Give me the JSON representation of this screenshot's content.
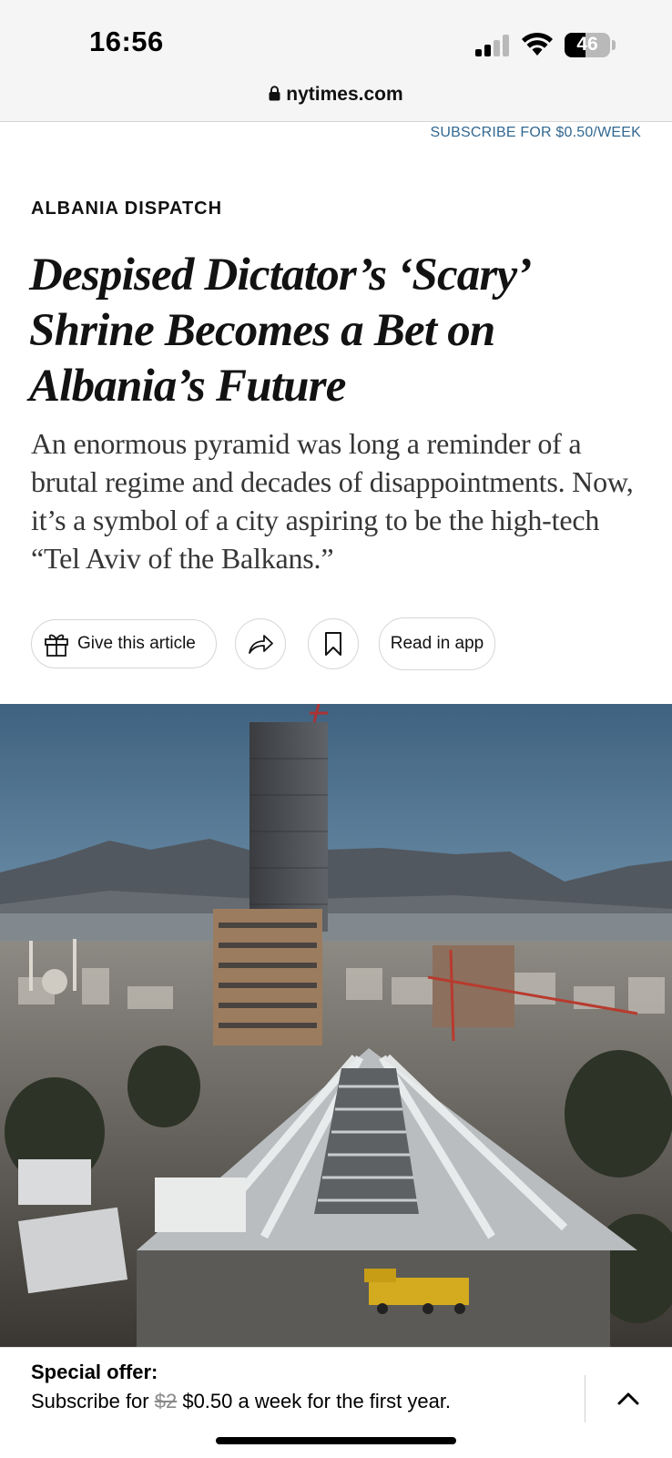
{
  "status_bar": {
    "time": "16:56",
    "battery": "46",
    "signal_icon": "cellular-signal-icon",
    "wifi_icon": "wifi-icon"
  },
  "browser": {
    "url": "nytimes.com",
    "lock_icon": "lock-icon"
  },
  "header": {
    "subscribe_link": "SUBSCRIBE FOR $0.50/WEEK"
  },
  "article": {
    "kicker": "ALBANIA DISPATCH",
    "headline": "Despised Dictator’s ‘Scary’ Shrine Becomes a Bet on Albania’s Future",
    "summary": "An enormous pyramid was long a reminder of a brutal regime and decades of disappointments. Now, it’s a symbol of a city aspiring to be the high-tech “Tel Aviv of the Balkans.”",
    "hero_image_icon": "pyramid-of-tirana-photo"
  },
  "actions": {
    "give_label": "Give this article",
    "gift_icon": "gift-icon",
    "share_icon": "share-icon",
    "bookmark_icon": "bookmark-icon",
    "read_in_app_label": "Read in app"
  },
  "offer": {
    "title": "Special offer:",
    "prefix": "Subscribe for ",
    "old_price": "$2",
    "new_price_text": " $0.50 a week for the first year.",
    "collapse_icon": "chevron-up-icon"
  },
  "colors": {
    "link_blue": "#326891",
    "text": "#121212",
    "summary_text": "#363636",
    "chrome_bg": "#f5f5f5"
  }
}
